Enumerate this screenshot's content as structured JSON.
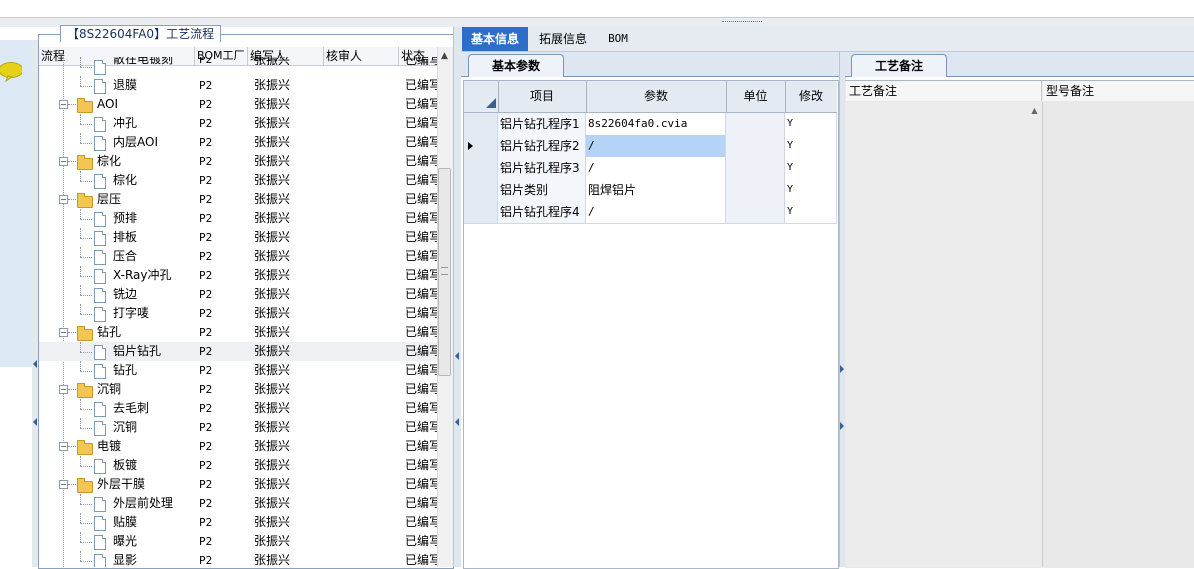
{
  "process_panel": {
    "title": "【8S22604FA0】工艺流程",
    "columns": [
      "流程",
      "BOM工厂",
      "编写人",
      "核审人",
      "状态"
    ],
    "rows": [
      {
        "name": "散在电镀刻",
        "depth": 1,
        "kind": "doc",
        "bom": "P2",
        "writer": "张振兴",
        "reviewer": "",
        "status": "已编写",
        "partial": true
      },
      {
        "name": "退膜",
        "depth": 1,
        "kind": "doc",
        "bom": "P2",
        "writer": "张振兴",
        "reviewer": "",
        "status": "已编写"
      },
      {
        "name": "AOI",
        "depth": 0,
        "kind": "folder",
        "bom": "P2",
        "writer": "张振兴",
        "reviewer": "",
        "status": "已编写"
      },
      {
        "name": "冲孔",
        "depth": 1,
        "kind": "doc",
        "bom": "P2",
        "writer": "张振兴",
        "reviewer": "",
        "status": "已编写"
      },
      {
        "name": "内层AOI",
        "depth": 1,
        "kind": "doc",
        "bom": "P2",
        "writer": "张振兴",
        "reviewer": "",
        "status": "已编写"
      },
      {
        "name": "棕化",
        "depth": 0,
        "kind": "folder",
        "bom": "P2",
        "writer": "张振兴",
        "reviewer": "",
        "status": "已编写"
      },
      {
        "name": "棕化",
        "depth": 1,
        "kind": "doc",
        "bom": "P2",
        "writer": "张振兴",
        "reviewer": "",
        "status": "已编写"
      },
      {
        "name": "层压",
        "depth": 0,
        "kind": "folder",
        "bom": "P2",
        "writer": "张振兴",
        "reviewer": "",
        "status": "已编写"
      },
      {
        "name": "预排",
        "depth": 1,
        "kind": "doc",
        "bom": "P2",
        "writer": "张振兴",
        "reviewer": "",
        "status": "已编写"
      },
      {
        "name": "排板",
        "depth": 1,
        "kind": "doc",
        "bom": "P2",
        "writer": "张振兴",
        "reviewer": "",
        "status": "已编写"
      },
      {
        "name": "压合",
        "depth": 1,
        "kind": "doc",
        "bom": "P2",
        "writer": "张振兴",
        "reviewer": "",
        "status": "已编写"
      },
      {
        "name": "X-Ray冲孔",
        "depth": 1,
        "kind": "doc",
        "bom": "P2",
        "writer": "张振兴",
        "reviewer": "",
        "status": "已编写"
      },
      {
        "name": "铣边",
        "depth": 1,
        "kind": "doc",
        "bom": "P2",
        "writer": "张振兴",
        "reviewer": "",
        "status": "已编写"
      },
      {
        "name": "打字唛",
        "depth": 1,
        "kind": "doc",
        "bom": "P2",
        "writer": "张振兴",
        "reviewer": "",
        "status": "已编写"
      },
      {
        "name": "钻孔",
        "depth": 0,
        "kind": "folder",
        "bom": "P2",
        "writer": "张振兴",
        "reviewer": "",
        "status": "已编写"
      },
      {
        "name": "铝片钻孔",
        "depth": 1,
        "kind": "doc",
        "bom": "P2",
        "writer": "张振兴",
        "reviewer": "",
        "status": "已编写",
        "selected": true
      },
      {
        "name": "钻孔",
        "depth": 1,
        "kind": "doc",
        "bom": "P2",
        "writer": "张振兴",
        "reviewer": "",
        "status": "已编写"
      },
      {
        "name": "沉铜",
        "depth": 0,
        "kind": "folder",
        "bom": "P2",
        "writer": "张振兴",
        "reviewer": "",
        "status": "已编写"
      },
      {
        "name": "去毛刺",
        "depth": 1,
        "kind": "doc",
        "bom": "P2",
        "writer": "张振兴",
        "reviewer": "",
        "status": "已编写"
      },
      {
        "name": "沉铜",
        "depth": 1,
        "kind": "doc",
        "bom": "P2",
        "writer": "张振兴",
        "reviewer": "",
        "status": "已编写"
      },
      {
        "name": "电镀",
        "depth": 0,
        "kind": "folder",
        "bom": "P2",
        "writer": "张振兴",
        "reviewer": "",
        "status": "已编写"
      },
      {
        "name": "板镀",
        "depth": 1,
        "kind": "doc",
        "bom": "P2",
        "writer": "张振兴",
        "reviewer": "",
        "status": "已编写"
      },
      {
        "name": "外层干膜",
        "depth": 0,
        "kind": "folder",
        "bom": "P2",
        "writer": "张振兴",
        "reviewer": "",
        "status": "已编写"
      },
      {
        "name": "外层前处理",
        "depth": 1,
        "kind": "doc",
        "bom": "P2",
        "writer": "张振兴",
        "reviewer": "",
        "status": "已编写"
      },
      {
        "name": "贴膜",
        "depth": 1,
        "kind": "doc",
        "bom": "P2",
        "writer": "张振兴",
        "reviewer": "",
        "status": "已编写"
      },
      {
        "name": "曝光",
        "depth": 1,
        "kind": "doc",
        "bom": "P2",
        "writer": "张振兴",
        "reviewer": "",
        "status": "已编写"
      },
      {
        "name": "显影",
        "depth": 1,
        "kind": "doc",
        "bom": "P2",
        "writer": "张振兴",
        "reviewer": "",
        "status": "已编写"
      }
    ]
  },
  "tabs": [
    "基本信息",
    "拓展信息",
    "BOM"
  ],
  "active_tab": "基本信息",
  "basic_params": {
    "tab_label": "基本参数",
    "columns": [
      "项目",
      "参数",
      "单位",
      "修改"
    ],
    "rows": [
      {
        "item": "铝片钻孔程序1",
        "param": "8s22604fa0.cvia",
        "unit": "",
        "modify": "Y"
      },
      {
        "item": "铝片钻孔程序2",
        "param": "/",
        "unit": "",
        "modify": "Y",
        "current": true
      },
      {
        "item": "铝片钻孔程序3",
        "param": "/",
        "unit": "",
        "modify": "Y"
      },
      {
        "item": "铝片类别",
        "param": "阻焊铝片",
        "unit": "",
        "modify": "Y"
      },
      {
        "item": "铝片钻孔程序4",
        "param": "/",
        "unit": "",
        "modify": "Y"
      }
    ]
  },
  "remarks": {
    "tab_label": "工艺备注",
    "columns": [
      "工艺备注",
      "型号备注"
    ]
  },
  "colors": {
    "active_tab_bg": "#2d6ec9",
    "folder": "#f3c654",
    "selected_cell": "#b5d3f7",
    "chat_icon": "#e4d21a"
  }
}
